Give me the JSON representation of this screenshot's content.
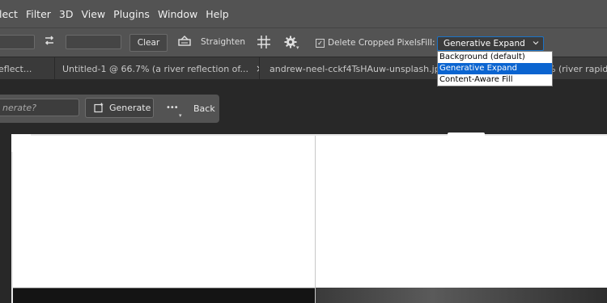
{
  "menu": [
    "lect",
    "Filter",
    "3D",
    "View",
    "Plugins",
    "Window",
    "Help"
  ],
  "options": {
    "clear_label": "Clear",
    "straighten_label": "Straighten",
    "delete_cropped_label": "Delete Cropped Pixels",
    "delete_cropped_checked": true,
    "fill_label": "Fill:",
    "fill_value": "Generative Expand",
    "fill_options": [
      "Background (default)",
      "Generative Expand",
      "Content-Aware Fill"
    ]
  },
  "tabs": [
    {
      "title": "eflect...",
      "close": "×"
    },
    {
      "title": "Untitled-1 @ 66.7% (a river reflection of...",
      "close": "×"
    },
    {
      "title": "andrew-neel-cckf4TsHAuw-unsplash.jpg",
      "close": ""
    },
    {
      "title": "% (river rapid",
      "close": ""
    }
  ],
  "contextual": {
    "prompt_placeholder": "nerate?",
    "generate_label": "Generate",
    "more_label": "•••",
    "back_label": "Back"
  },
  "colors": {
    "accent": "#0a64d0",
    "panel": "#535353",
    "tabbar": "#3a3a3a"
  }
}
